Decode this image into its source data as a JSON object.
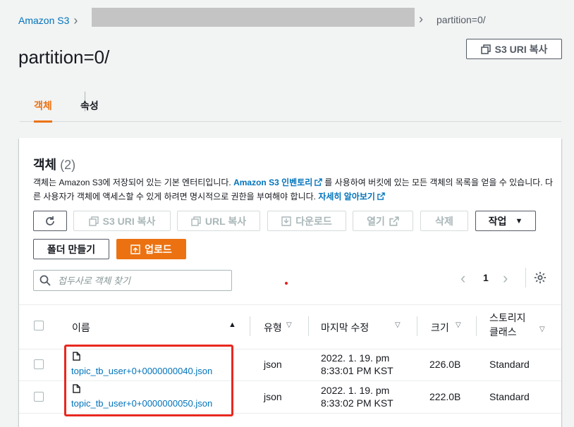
{
  "breadcrumb": {
    "root": "Amazon S3",
    "current": "partition=0/"
  },
  "page": {
    "title": "partition=0/",
    "copy_uri_label": "S3 URI 복사"
  },
  "tabs": [
    {
      "label": "객체",
      "active": true
    },
    {
      "label": "속성",
      "active": false
    }
  ],
  "objects_panel": {
    "title": "객체",
    "count": "(2)",
    "desc_part1": "객체는 Amazon S3에 저장되어 있는 기본 엔터티입니다. ",
    "desc_link1": "Amazon S3 인벤토리",
    "desc_part2": "를 사용하여 버킷에 있는 모든 객체의 목록을 얻을 수 있습니다. 다른 사용자가 객체에 액세스할 수 있게 하려면 명시적으로 권한을 부여해야 합니다. ",
    "desc_link2": "자세히 알아보기"
  },
  "toolbar": {
    "copy_s3_uri": "S3 URI 복사",
    "copy_url": "URL 복사",
    "download": "다운로드",
    "open": "열기",
    "delete": "삭제",
    "actions": "작업",
    "create_folder": "폴더 만들기",
    "upload": "업로드"
  },
  "search": {
    "placeholder": "접두사로 객체 찾기"
  },
  "pagination": {
    "page": "1"
  },
  "table": {
    "headers": {
      "name": "이름",
      "type": "유형",
      "last_modified": "마지막 수정",
      "size": "크기",
      "storage_class_line1": "스토리지",
      "storage_class_line2": "클래스"
    },
    "rows": [
      {
        "name": "topic_tb_user+0+0000000040.json",
        "type": "json",
        "modified_line1": "2022. 1. 19. pm",
        "modified_line2": "8:33:01 PM KST",
        "size": "226.0B",
        "storage_class": "Standard"
      },
      {
        "name": "topic_tb_user+0+0000000050.json",
        "type": "json",
        "modified_line1": "2022. 1. 19. pm",
        "modified_line2": "8:33:02 PM KST",
        "size": "222.0B",
        "storage_class": "Standard"
      }
    ]
  },
  "colors": {
    "accent": "#ec7211",
    "link": "#0073bb",
    "highlight": "#e8281f"
  }
}
